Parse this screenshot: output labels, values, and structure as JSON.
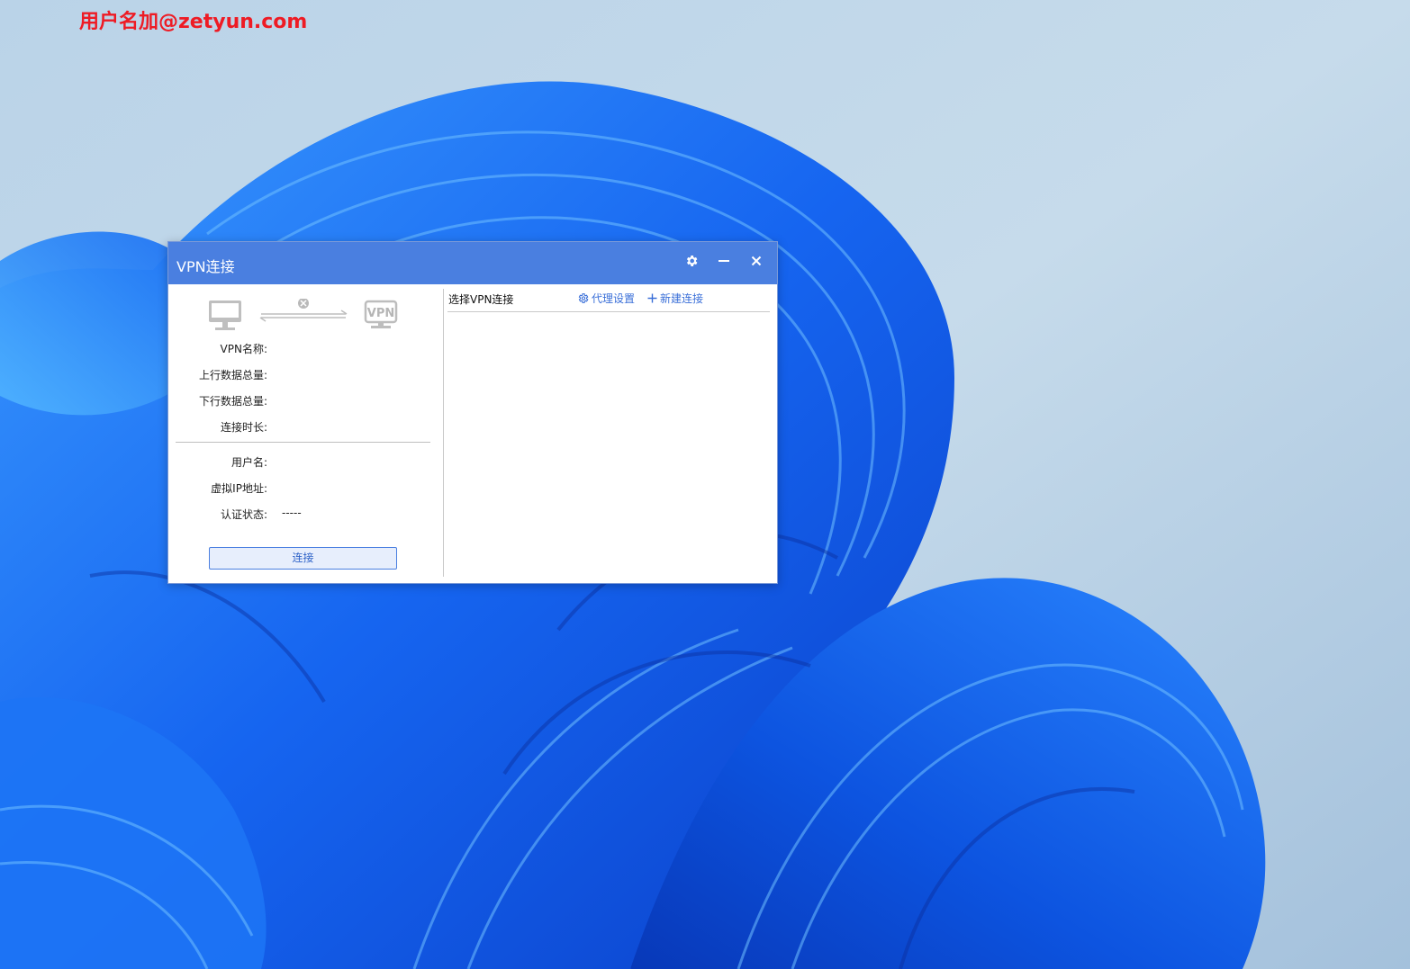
{
  "overlay": {
    "text": "用户名加@zetyun.com"
  },
  "window": {
    "title": "VPN连接",
    "icons": {
      "settings": "gear-icon",
      "minimize": "minimize-icon",
      "close": "close-icon"
    }
  },
  "status_graphic": {
    "computer_icon": "monitor-icon",
    "link_state_icon": "disconnected-x-icon",
    "vpn_badge": "VPN"
  },
  "info": {
    "vpn_name": {
      "label": "VPN名称:",
      "value": ""
    },
    "upload_total": {
      "label": "上行数据总量:",
      "value": ""
    },
    "download_total": {
      "label": "下行数据总量:",
      "value": ""
    },
    "duration": {
      "label": "连接时长:",
      "value": ""
    },
    "username": {
      "label": "用户名:",
      "value": ""
    },
    "virtual_ip": {
      "label": "虚拟IP地址:",
      "value": ""
    },
    "auth_status": {
      "label": "认证状态:",
      "value": "-----"
    }
  },
  "connect_button": "连接",
  "right": {
    "select_label": "选择VPN连接",
    "proxy_settings": "代理设置",
    "new_connection": "新建连接",
    "connections": []
  },
  "colors": {
    "titlebar": "#4a7fe0",
    "accent": "#3a6fd8",
    "overlay_text": "#ee1b24"
  }
}
